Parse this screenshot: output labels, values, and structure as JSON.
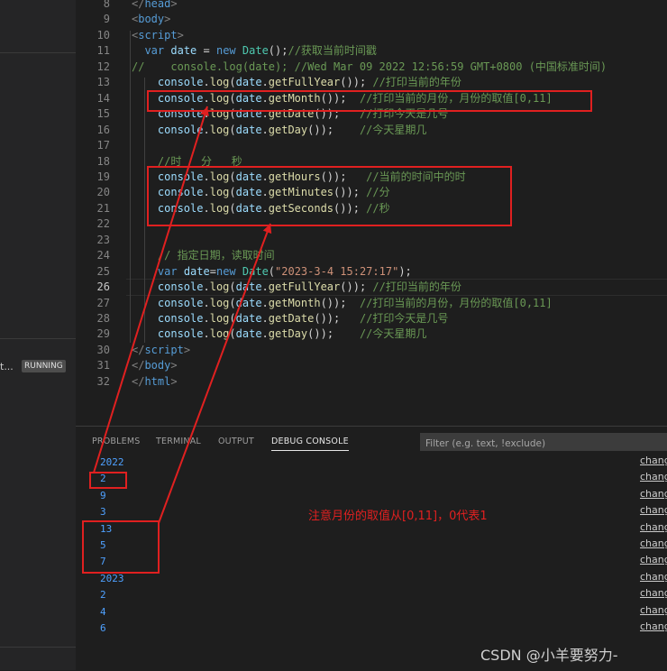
{
  "sidebar": {
    "task_label": "t...",
    "running_badge": "RUNNING"
  },
  "editor": {
    "lines": [
      {
        "num": "8",
        "html": "<span class=\"pun\">&lt;/</span><span class=\"tag\">head</span><span class=\"pun\">&gt;</span>"
      },
      {
        "num": "9",
        "html": "<span class=\"pun\">&lt;</span><span class=\"tag\">body</span><span class=\"pun\">&gt;</span>"
      },
      {
        "num": "10",
        "html": "<span class=\"pun\">&lt;</span><span class=\"tag\">script</span><span class=\"pun\">&gt;</span>"
      },
      {
        "num": "11",
        "html": "  <span class=\"kw\">var</span> <span class=\"var\">date</span> = <span class=\"kw\">new</span> <span class=\"cls\">Date</span>();<span class=\"cm\">//获取当前时间戳</span>"
      },
      {
        "num": "12",
        "html": "<span class=\"cm\">//    console.log(date); //Wed Mar 09 2022 12:56:59 GMT+0800 (中国标准时间)</span>"
      },
      {
        "num": "13",
        "html": "    <span class=\"var\">console</span>.<span class=\"fn\">log</span>(<span class=\"var\">date</span>.<span class=\"fn\">getFullYear</span>()); <span class=\"cm\">//打印当前的年份</span>"
      },
      {
        "num": "14",
        "html": "    <span class=\"var\">console</span>.<span class=\"fn\">log</span>(<span class=\"var\">date</span>.<span class=\"fn\">getMonth</span>());  <span class=\"cm\">//打印当前的月份，月份的取值[0,11]</span>"
      },
      {
        "num": "15",
        "html": "    <span class=\"var\">console</span>.<span class=\"fn\">log</span>(<span class=\"var\">date</span>.<span class=\"fn\">getDate</span>());   <span class=\"cm\">//打印今天是几号</span>"
      },
      {
        "num": "16",
        "html": "    <span class=\"var\">console</span>.<span class=\"fn\">log</span>(<span class=\"var\">date</span>.<span class=\"fn\">getDay</span>());    <span class=\"cm\">//今天星期几</span>"
      },
      {
        "num": "17",
        "html": ""
      },
      {
        "num": "18",
        "html": "    <span class=\"cm\">//时   分   秒</span>"
      },
      {
        "num": "19",
        "html": "    <span class=\"var\">console</span>.<span class=\"fn\">log</span>(<span class=\"var\">date</span>.<span class=\"fn\">getHours</span>());   <span class=\"cm\">//当前的时间中的时</span>"
      },
      {
        "num": "20",
        "html": "    <span class=\"var\">console</span>.<span class=\"fn\">log</span>(<span class=\"var\">date</span>.<span class=\"fn\">getMinutes</span>()); <span class=\"cm\">//分</span>"
      },
      {
        "num": "21",
        "html": "    <span class=\"var\">console</span>.<span class=\"fn\">log</span>(<span class=\"var\">date</span>.<span class=\"fn\">getSeconds</span>()); <span class=\"cm\">//秒</span>"
      },
      {
        "num": "22",
        "html": ""
      },
      {
        "num": "23",
        "html": ""
      },
      {
        "num": "24",
        "html": "    <span class=\"cm\">// 指定日期，读取时间</span>"
      },
      {
        "num": "25",
        "html": "    <span class=\"kw\">var</span> <span class=\"var\">date</span>=<span class=\"kw\">new</span> <span class=\"cls\">Date</span>(<span class=\"str\">\"2023-3-4 15:27:17\"</span>);"
      },
      {
        "num": "26",
        "html": "    <span class=\"var\">console</span>.<span class=\"fn\">log</span>(<span class=\"var\">date</span>.<span class=\"fn\">getFullYear</span>()); <span class=\"cm\">//打印当前的年份</span>"
      },
      {
        "num": "27",
        "html": "    <span class=\"var\">console</span>.<span class=\"fn\">log</span>(<span class=\"var\">date</span>.<span class=\"fn\">getMonth</span>());  <span class=\"cm\">//打印当前的月份，月份的取值[0,11]</span>"
      },
      {
        "num": "28",
        "html": "    <span class=\"var\">console</span>.<span class=\"fn\">log</span>(<span class=\"var\">date</span>.<span class=\"fn\">getDate</span>());   <span class=\"cm\">//打印今天是几号</span>"
      },
      {
        "num": "29",
        "html": "    <span class=\"var\">console</span>.<span class=\"fn\">log</span>(<span class=\"var\">date</span>.<span class=\"fn\">getDay</span>());    <span class=\"cm\">//今天星期几</span>"
      },
      {
        "num": "30",
        "html": "<span class=\"pun\">&lt;/</span><span class=\"tag\">script</span><span class=\"pun\">&gt;</span>"
      },
      {
        "num": "31",
        "html": "<span class=\"pun\">&lt;/</span><span class=\"tag\">body</span><span class=\"pun\">&gt;</span>"
      },
      {
        "num": "32",
        "html": "<span class=\"pun\">&lt;/</span><span class=\"tag\">html</span><span class=\"pun\">&gt;</span>"
      }
    ]
  },
  "panel": {
    "tabs": [
      {
        "label": "PROBLEMS"
      },
      {
        "label": "TERMINAL"
      },
      {
        "label": "OUTPUT"
      },
      {
        "label": "DEBUG CONSOLE",
        "active": true
      }
    ],
    "filter_placeholder": "Filter (e.g. text, !exclude)",
    "output": [
      "2022",
      "2",
      "9",
      "3",
      "13",
      "5",
      "7",
      "2023",
      "2",
      "4",
      "6"
    ],
    "source_link": "chang"
  },
  "annotation": {
    "note": "注意月份的取值从[0,11]，0代表1",
    "color": "#e02020"
  },
  "watermark": "CSDN @小羊要努力-"
}
